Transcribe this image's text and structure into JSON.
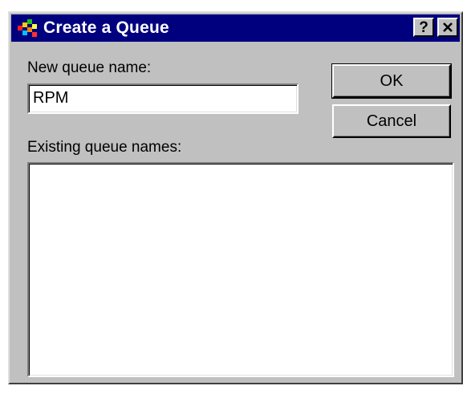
{
  "window": {
    "title": "Create a Queue",
    "help_button": "?",
    "close_button": "✕"
  },
  "form": {
    "new_queue_label": "New queue name:",
    "new_queue_value": "RPM",
    "existing_label": "Existing queue names:",
    "existing_items": []
  },
  "buttons": {
    "ok": "OK",
    "cancel": "Cancel"
  },
  "colors": {
    "titlebar": "#00007f",
    "face": "#c0c0c0"
  }
}
